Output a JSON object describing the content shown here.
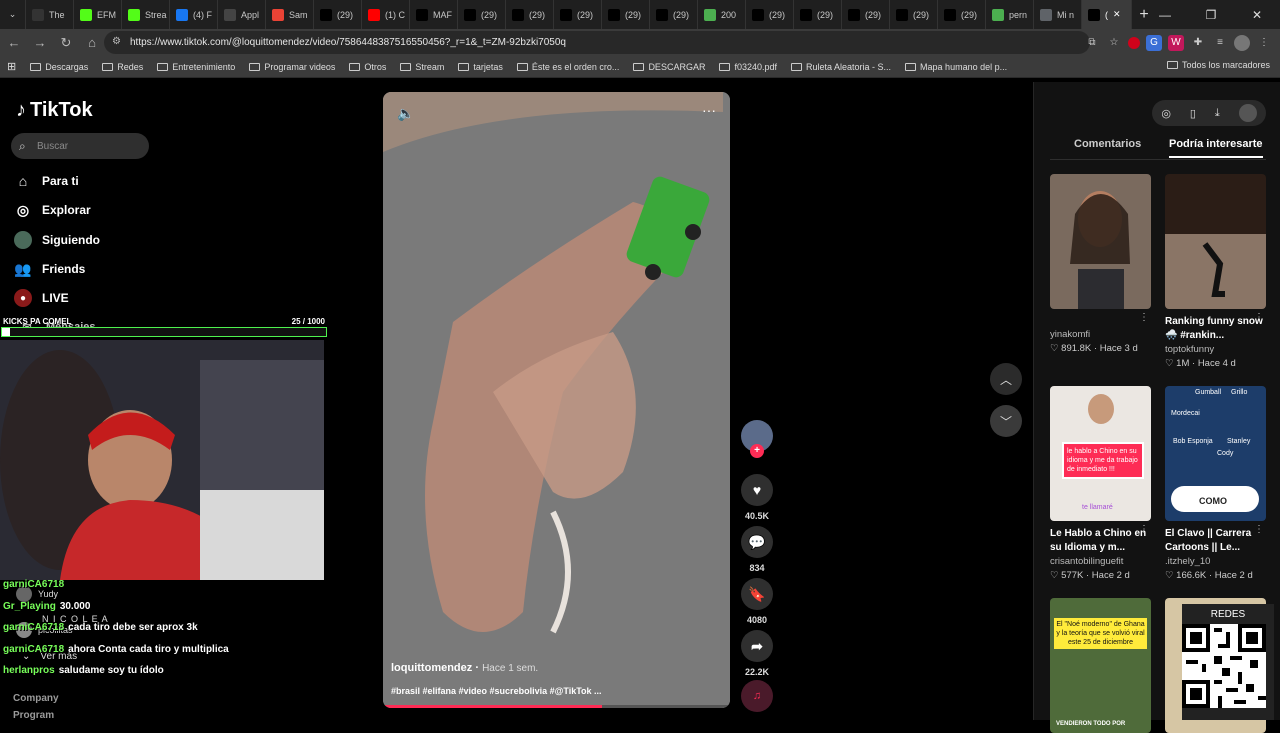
{
  "browser": {
    "tabs": [
      {
        "label": "The",
        "icon": "github-icon",
        "color": "#333333"
      },
      {
        "label": "EFM",
        "icon": "kick-icon",
        "color": "#53fc18"
      },
      {
        "label": "Strea",
        "icon": "kick-icon",
        "color": "#53fc18"
      },
      {
        "label": "(4) F",
        "icon": "facebook-icon",
        "color": "#1877f2"
      },
      {
        "label": "Appl",
        "icon": "vs-icon",
        "color": "#444444"
      },
      {
        "label": "Sam",
        "icon": "gmail-icon",
        "color": "#ea4335"
      },
      {
        "label": "(29)",
        "icon": "tiktok-icon",
        "color": "#000000"
      },
      {
        "label": "(1) C",
        "icon": "youtube-icon",
        "color": "#ff0000"
      },
      {
        "label": "MAF",
        "icon": "tiktok-icon",
        "color": "#000000"
      },
      {
        "label": "(29)",
        "icon": "tiktok-icon",
        "color": "#000000"
      },
      {
        "label": "(29)",
        "icon": "tiktok-icon",
        "color": "#000000"
      },
      {
        "label": "(29)",
        "icon": "tiktok-icon",
        "color": "#000000"
      },
      {
        "label": "(29)",
        "icon": "tiktok-icon",
        "color": "#000000"
      },
      {
        "label": "(29)",
        "icon": "tiktok-icon",
        "color": "#000000"
      },
      {
        "label": "200",
        "icon": "chrome-icon",
        "color": "#4caf50"
      },
      {
        "label": "(29)",
        "icon": "tiktok-icon",
        "color": "#000000"
      },
      {
        "label": "(29)",
        "icon": "tiktok-icon",
        "color": "#000000"
      },
      {
        "label": "(29)",
        "icon": "tiktok-icon",
        "color": "#000000"
      },
      {
        "label": "(29)",
        "icon": "tiktok-icon",
        "color": "#000000"
      },
      {
        "label": "(29)",
        "icon": "tiktok-icon",
        "color": "#000000"
      },
      {
        "label": "pern",
        "icon": "chrome-icon",
        "color": "#4caf50"
      },
      {
        "label": "Mi n",
        "icon": "generic-icon",
        "color": "#5f6368"
      },
      {
        "label": "(",
        "icon": "tiktok-icon",
        "color": "#000000"
      }
    ],
    "url": "https://www.tiktok.com/@loquittomendez/video/7586448387516550456?_r=1&_t=ZM-92bzki7050q",
    "bookmarks": [
      "Descargas",
      "Redes",
      "Entretenimiento",
      "Programar videos",
      "Otros",
      "Stream",
      "tarjetas",
      "Éste es el orden cro...",
      "DESCARGAR",
      "f03240.pdf",
      "Ruleta Aleatoria - S...",
      "Mapa humano del p..."
    ],
    "bookmarks_all": "Todos los marcadores"
  },
  "sidebar": {
    "logo": "TikTok",
    "search_placeholder": "Buscar",
    "items": [
      {
        "label": "Para ti",
        "icon": "home-icon"
      },
      {
        "label": "Explorar",
        "icon": "compass-icon"
      },
      {
        "label": "Siguiendo",
        "icon": "following-avatar-icon"
      },
      {
        "label": "Friends",
        "icon": "friends-icon"
      },
      {
        "label": "LIVE",
        "icon": "live-icon"
      },
      {
        "label": "Mensajes",
        "icon": "messages-icon"
      }
    ],
    "following": [
      {
        "name": "Yudy"
      },
      {
        "name": "picoliitas"
      },
      {
        "name": "N I C O L E A"
      }
    ],
    "ver_mas": "Ver más",
    "footer": [
      "Company",
      "Program"
    ]
  },
  "stream_overlay": {
    "goal_label": "KICKS PA COMEL",
    "goal_count": "25 / 1000",
    "goal_fraction": 0.025,
    "chat": [
      {
        "user": "garniCA6718",
        "msg": ""
      },
      {
        "user": "Gr_Playing",
        "msg": "30.000"
      },
      {
        "user": "garniCA6718",
        "msg": "cada tiro debe ser aprox 3k"
      },
      {
        "user": "garniCA6718",
        "msg": "ahora Conta cada tiro y multiplica"
      },
      {
        "user": "herlanpros",
        "msg": "saludame soy tu ídolo"
      }
    ]
  },
  "video": {
    "author": "loquittomendez",
    "time_ago": "Hace 1 sem.",
    "caption": "#brasil #elifana #video #sucrebolivia #@TikTok ...",
    "progress_fraction": 0.63
  },
  "actions": {
    "likes": "40.5K",
    "comments": "834",
    "saves": "4080",
    "shares": "22.2K"
  },
  "right_panel": {
    "tabs": [
      "Comentarios",
      "Podría interesarte"
    ],
    "active_tab": 1,
    "cards": [
      {
        "title": "",
        "author": "yinakomfi",
        "likes": "891.8K",
        "ago": "Hace 3 d",
        "bg": "#6a5a4e"
      },
      {
        "title": "Ranking funny snow 🌨️ #rankin...",
        "author": "toptokfunny",
        "likes": "1M",
        "ago": "Hace 4 d",
        "bg": "#3a2a22"
      },
      {
        "title": "Le Hablo a Chino en su Idioma y m...",
        "author": "crisantobilinguefit",
        "likes": "577K",
        "ago": "Hace 2 d",
        "bg": "#e9e5e0"
      },
      {
        "title": "El Clavo || Carrera Cartoons || Le...",
        "author": ".itzhely_10",
        "likes": "166.6K",
        "ago": "Hace 2 d",
        "bg": "#1f3f6e"
      },
      {
        "title": "",
        "author": "",
        "likes": "",
        "ago": "",
        "bg": "#4d6a3a"
      },
      {
        "title": "",
        "author": "",
        "likes": "",
        "ago": "",
        "bg": "#d9c9a7"
      }
    ],
    "card3_overlay": "le hablo a Chino en su idioma y me da trabajo de inmediato !!!",
    "card3_sub": "te llamaré",
    "card4_overlay": "COMO",
    "card4_names": [
      "Gumball",
      "Grillo",
      "Mordecai",
      "Stanley",
      "Bob Esponja",
      "Cody"
    ],
    "card5_overlay": "El \"Noé moderno\" de Ghana y la teoría que se volvió viral este 25 de diciembre",
    "card5_bottom": "VENDIERON TODO POR",
    "qr_title": "REDES"
  }
}
